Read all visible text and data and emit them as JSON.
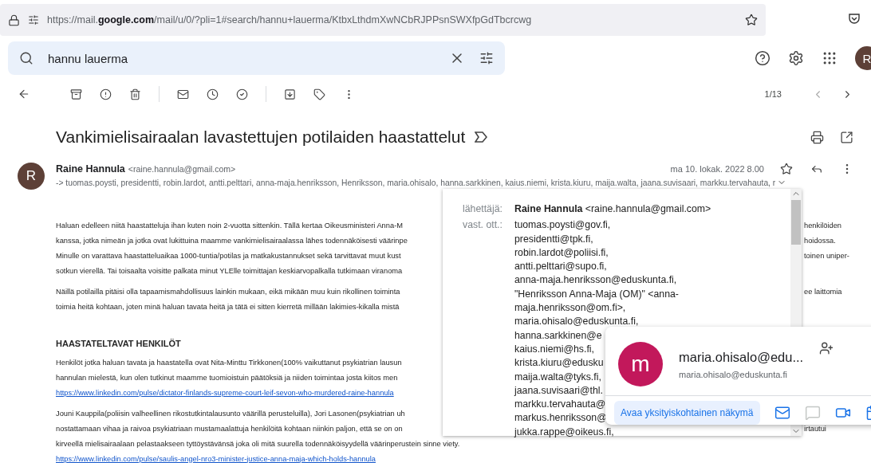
{
  "browser": {
    "url": "https://mail.**google.com**/mail/u/0/?pli=1#search/hannu+lauerma/KtbxLthdmXwNCbRJPPsnSWXfpGdTbcrcwg"
  },
  "search": {
    "value": "hannu lauerma"
  },
  "account": {
    "initial": "R"
  },
  "toolbar": {
    "pager": "1/13"
  },
  "message": {
    "subject": "Vankimielisairaalan lavastettujen potilaiden haastattelut",
    "sender": {
      "initial": "R",
      "name": "Raine Hannula",
      "email": "<raine.hannula@gmail.com>"
    },
    "date": "ma 10. lokak. 2022 8.00",
    "recipients_line": "-> tuomas.poysti, presidentti, robin.lardot, antti.pelttari, anna-maja.henriksson, Henriksson, maria.ohisalo, hanna.sarkkinen, kaius.niemi, krista.kiuru, maija.walta, jaana.suvisaari, markku.tervahauta, r",
    "body": [
      {
        "kind": "paragraph",
        "lines": [
          {
            "kind": "text",
            "text": "Haluan edelleen niitä haastatteluja ihan kuten noin 2-vuotta sittenkin. Tällä kertaa Oikeusministeri Anna-M",
            "right": "henkilöiden"
          },
          {
            "kind": "text",
            "text": "kanssa, jotka nimeän ja jotka ovat lukittuina maamme vankimielisairaalassa lähes todennäköisesti väärinpe",
            "right": "hoidossa."
          },
          {
            "kind": "text",
            "text": "Minulle on varattava haastatteluaikaa 1000-tuntia/potilas ja matkakustannukset sekä tarvittavat muut kust",
            "right": "toinen uniper-"
          },
          {
            "kind": "text",
            "text": "sotkun vierellä. Tai toisaalta voisitte palkata minut YLElle toimittajan keskiarvopalkalla tutkimaan viranoma"
          }
        ]
      },
      {
        "kind": "paragraph",
        "lines": [
          {
            "kind": "text",
            "text": "Näillä potilailla pitäisi olla tapaamismahdollisuus lainkin mukaan, eikä mikään muu kuin rikollinen toiminta",
            "right": "ee laittomia"
          },
          {
            "kind": "text",
            "text": "toimia heitä kohtaan, joten minä haluan tavata heitä ja tätä ei sitten kierretä millään lakimies-kikalla mistä"
          }
        ]
      },
      {
        "kind": "heading",
        "text": "HAASTATELTAVAT HENKILÖT"
      },
      {
        "kind": "paragraph",
        "lines": [
          {
            "kind": "text",
            "text": "Henkilöt jotka haluan tavata ja haastatella ovat Nita-Minttu Tirkkonen(100% vaikuttanut psykiatrian lausun"
          },
          {
            "kind": "text",
            "text": "hannulan mielestä, kun olen tutkinut maamme tuomioistuin päätöksiä ja niiden toimintaa josta kiitos men"
          },
          {
            "kind": "link",
            "text": "https://www.linkedin.com/pulse/dictator-finlands-supreme-court-leif-sevon-who-murdered-raine-hannula"
          }
        ]
      },
      {
        "kind": "paragraph",
        "lines": [
          {
            "kind": "text",
            "text": "Jouni Kauppila(poliisin valheellinen rikostutkintalausunto väärillä perusteluilla), Jori Lasonen(psykiatrian uh"
          },
          {
            "kind": "text",
            "text": "nostattamaan vihaa ja raivoa psykiatriaan mustamaalattuja henkilöitä kohtaan niinkin paljon, että se on on",
            "right": "irtautui"
          },
          {
            "kind": "text",
            "text": "kirveellä mielisairaalaan pelastaakseen tyttöystävänsä joka oli mitä suurella todennäköisyydellä väärinperustein sinne viety."
          },
          {
            "kind": "link",
            "text": "https://www.linkedin.com/pulse/saulis-angel-nro3-minister-justice-anna-maja-which-holds-hannula"
          }
        ]
      }
    ]
  },
  "details_popup": {
    "from_label": "lähettäjä:",
    "from_name": "Raine Hannula",
    "from_email": "<raine.hannula@gmail.com>",
    "to_label": "vast. ott.:",
    "to": [
      "tuomas.poysti@gov.fi,",
      "presidentti@tpk.fi,",
      "robin.lardot@poliisi.fi,",
      "antti.pelttari@supo.fi,",
      "anna-maja.henriksson@eduskunta.fi,",
      "\"Henriksson Anna-Maja (OM)\" <anna-maja.henriksson@om.fi>,",
      "maria.ohisalo@eduskunta.fi,",
      "hanna.sarkkinen@e",
      "kaius.niemi@hs.fi,",
      "krista.kiuru@edusku",
      "maija.walta@tyks.fi,",
      "jaana.suvisaari@thl.",
      "markku.tervahauta@",
      "markus.henriksson@",
      "jukka.rappe@oikeus.fi,"
    ]
  },
  "contact_card": {
    "initial": "m",
    "name": "maria.ohisalo@edu...",
    "email": "maria.ohisalo@eduskunta.fi",
    "open_button": "Avaa yksityiskohtainen näkymä",
    "actions": [
      {
        "kind": "mail",
        "disabled": false
      },
      {
        "kind": "chat",
        "disabled": true
      },
      {
        "kind": "video",
        "disabled": false
      },
      {
        "kind": "calendar",
        "disabled": false
      }
    ]
  }
}
